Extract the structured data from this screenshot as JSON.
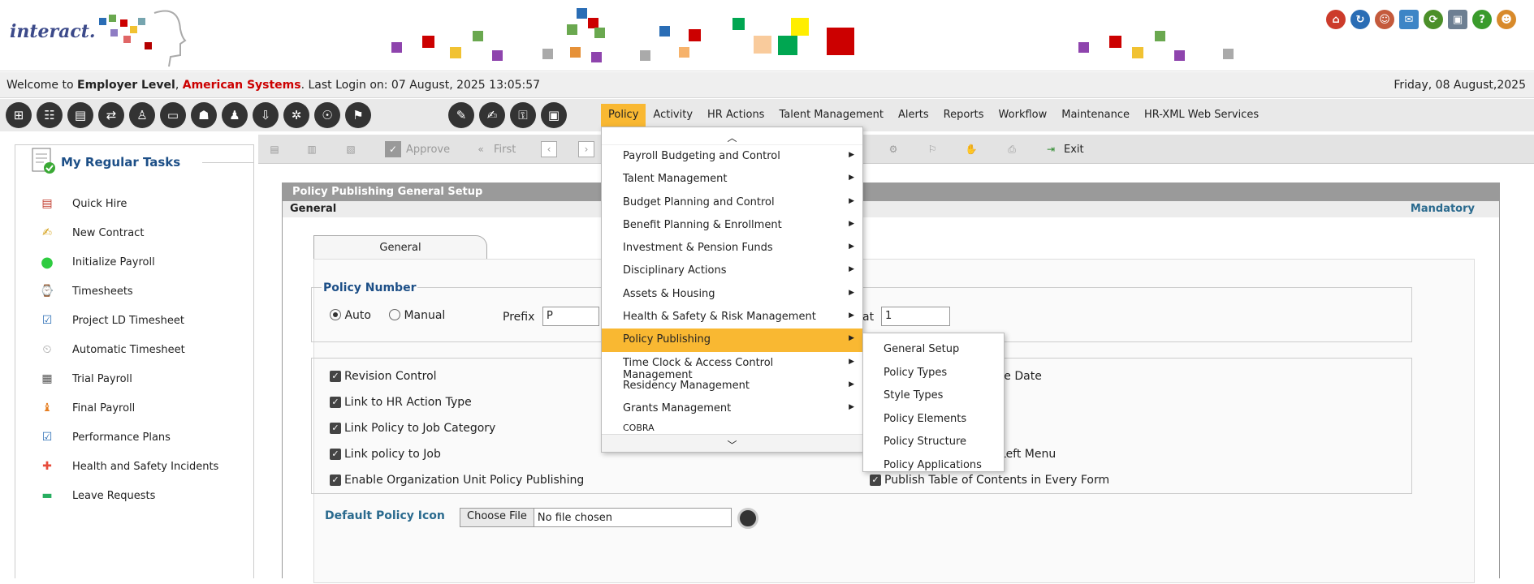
{
  "brand": {
    "name": "interact."
  },
  "welcome": {
    "prefix": "Welcome to",
    "level": "Employer Level",
    "sep": ",",
    "company": "American Systems",
    "login": ". Last Login on: 07 August, 2025 13:05:57",
    "date": "Friday, 08 August,2025"
  },
  "menubar": [
    "Policy",
    "Activity",
    "HR Actions",
    "Talent Management",
    "Alerts",
    "Reports",
    "Workflow",
    "Maintenance",
    "HR-XML Web Services"
  ],
  "sidebar": {
    "title": "My Regular Tasks",
    "items": [
      "Quick Hire",
      "New Contract",
      "Initialize Payroll",
      "Timesheets",
      "Project LD Timesheet",
      "Automatic Timesheet",
      "Trial Payroll",
      "Final Payroll",
      "Performance Plans",
      "Health and Safety Incidents",
      "Leave Requests"
    ]
  },
  "toolbar": {
    "approve": "Approve",
    "first": "First",
    "exit": "Exit"
  },
  "panel": {
    "title": "Policy Publishing General Setup",
    "section": "General",
    "mandatory": "Mandatory",
    "tab": "General",
    "policy_number": {
      "legend": "Policy Number",
      "auto": "Auto",
      "manual": "Manual",
      "prefix_label": "Prefix",
      "prefix_value": "P",
      "start_label_tail": "at",
      "start_value": "1"
    },
    "checks_left": [
      "Revision Control",
      "Link to HR Action Type",
      "Link Policy to Job Category",
      "Link policy to Job",
      "Enable Organization Unit Policy Publishing"
    ],
    "checks_right_partial": [
      "ve Date",
      "o Left Menu"
    ],
    "checks_right_full": "Publish Table of Contents in Every Form",
    "default_icon_label": "Default Policy Icon",
    "choose_file": "Choose File",
    "no_file": "No file chosen"
  },
  "dropdown": {
    "items": [
      "Payroll Budgeting and Control",
      "Talent Management",
      "Budget Planning and Control",
      "Benefit Planning & Enrollment",
      "Investment & Pension Funds",
      "Disciplinary Actions",
      "Assets & Housing",
      "Health & Safety & Risk Management",
      "Policy Publishing",
      "Time Clock & Access Control Management",
      "Residency Management",
      "Grants Management"
    ],
    "highlighted": "Policy Publishing",
    "partial": "COBRA"
  },
  "submenu": [
    "General Setup",
    "Policy Types",
    "Style Types",
    "Policy Elements",
    "Policy Structure",
    "Policy Applications"
  ],
  "colors": {
    "accent": "#f9b832",
    "brand_blue": "#1d4f87",
    "company_red": "#cc0000"
  }
}
